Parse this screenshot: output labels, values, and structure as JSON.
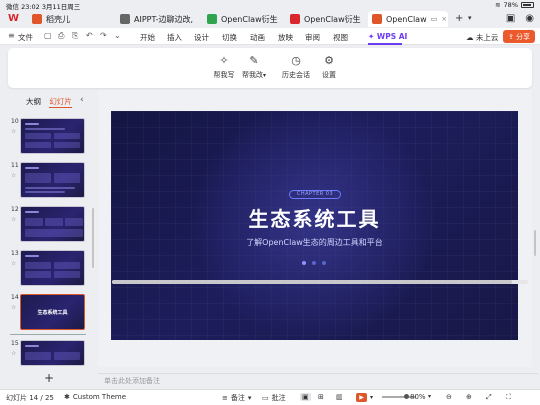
{
  "status_bar": {
    "carrier": "微信",
    "time": "23:02",
    "date": "3月11日周三",
    "battery_percent": "78%"
  },
  "tabs": [
    {
      "label": "稻壳儿",
      "icon_color": "#e0562b"
    },
    {
      "label": "AIPPT-边聊边改,",
      "icon_color": "#666666"
    },
    {
      "label": "OpenClaw衍生",
      "icon_color": "#2ea44f"
    },
    {
      "label": "OpenClaw衍生",
      "icon_color": "#d9272e"
    },
    {
      "label": "OpenClaw",
      "icon_color": "#e0562b"
    }
  ],
  "menu": {
    "file": "文件",
    "items": [
      "开始",
      "插入",
      "设计",
      "切换",
      "动画",
      "放映",
      "审阅",
      "视图"
    ],
    "wps_ai": "WPS AI",
    "cloud": "未上云",
    "share": "分享"
  },
  "ribbon": {
    "help_write": "帮我写",
    "help_edit": "帮我改",
    "history": "历史会话",
    "settings": "设置"
  },
  "left_panel": {
    "tab_outline": "大纲",
    "tab_slides": "幻灯片",
    "thumbnails": [
      {
        "num": "10"
      },
      {
        "num": "11"
      },
      {
        "num": "12"
      },
      {
        "num": "13"
      },
      {
        "num": "14",
        "title": "生态系统工具"
      },
      {
        "num": "15"
      }
    ]
  },
  "slide": {
    "chapter": "CHAPTER 03",
    "title": "生态系统工具",
    "subtitle": "了解OpenClaw生态的周边工具和平台"
  },
  "notes_placeholder": "单击此处添加备注",
  "bottom": {
    "slide_counter": "幻灯片 14 / 25",
    "theme": "Custom Theme",
    "notes": "备注",
    "comments": "批注",
    "zoom": "80%"
  }
}
